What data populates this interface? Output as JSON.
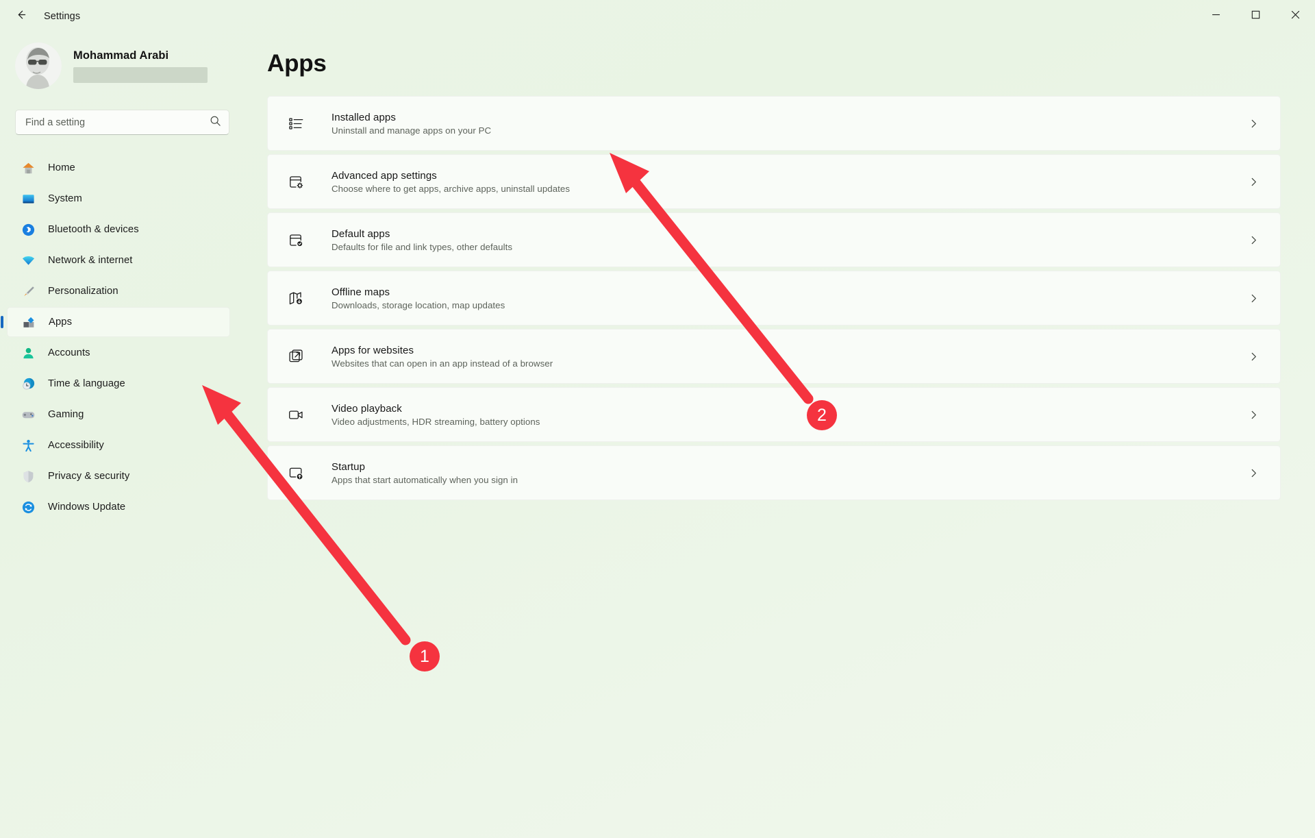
{
  "window": {
    "title": "Settings",
    "back_icon": "back-arrow-icon",
    "controls": {
      "minimize": "minimize-icon",
      "maximize": "maximize-icon",
      "close": "close-icon"
    }
  },
  "account": {
    "name": "Mohammad Arabi",
    "email_redacted": true,
    "avatar_alt": "user-avatar"
  },
  "search": {
    "placeholder": "Find a setting",
    "value": "",
    "icon": "search-icon"
  },
  "sidebar": {
    "items": [
      {
        "label": "Home",
        "icon": "home-icon",
        "selected": false
      },
      {
        "label": "System",
        "icon": "system-icon",
        "selected": false
      },
      {
        "label": "Bluetooth & devices",
        "icon": "bluetooth-icon",
        "selected": false
      },
      {
        "label": "Network & internet",
        "icon": "network-icon",
        "selected": false
      },
      {
        "label": "Personalization",
        "icon": "personalization-icon",
        "selected": false
      },
      {
        "label": "Apps",
        "icon": "apps-icon",
        "selected": true
      },
      {
        "label": "Accounts",
        "icon": "accounts-icon",
        "selected": false
      },
      {
        "label": "Time & language",
        "icon": "time-language-icon",
        "selected": false
      },
      {
        "label": "Gaming",
        "icon": "gaming-icon",
        "selected": false
      },
      {
        "label": "Accessibility",
        "icon": "accessibility-icon",
        "selected": false
      },
      {
        "label": "Privacy & security",
        "icon": "privacy-security-icon",
        "selected": false
      },
      {
        "label": "Windows Update",
        "icon": "windows-update-icon",
        "selected": false
      }
    ]
  },
  "main": {
    "page_title": "Apps",
    "cards": [
      {
        "title": "Installed apps",
        "subtitle": "Uninstall and manage apps on your PC",
        "icon": "installed-apps-list-icon",
        "chevron": "chevron-right-icon"
      },
      {
        "title": "Advanced app settings",
        "subtitle": "Choose where to get apps, archive apps, uninstall updates",
        "icon": "advanced-app-settings-gear-icon",
        "chevron": "chevron-right-icon"
      },
      {
        "title": "Default apps",
        "subtitle": "Defaults for file and link types, other defaults",
        "icon": "default-apps-check-icon",
        "chevron": "chevron-right-icon"
      },
      {
        "title": "Offline maps",
        "subtitle": "Downloads, storage location, map updates",
        "icon": "offline-maps-download-icon",
        "chevron": "chevron-right-icon"
      },
      {
        "title": "Apps for websites",
        "subtitle": "Websites that can open in an app instead of a browser",
        "icon": "apps-for-websites-external-link-icon",
        "chevron": "chevron-right-icon"
      },
      {
        "title": "Video playback",
        "subtitle": "Video adjustments, HDR streaming, battery options",
        "icon": "video-playback-camera-icon",
        "chevron": "chevron-right-icon"
      },
      {
        "title": "Startup",
        "subtitle": "Apps that start automatically when you sign in",
        "icon": "startup-upload-icon",
        "chevron": "chevron-right-icon"
      }
    ]
  },
  "annotations": {
    "color": "#f5333f",
    "markers": [
      {
        "label": "1",
        "target": "sidebar-item-apps"
      },
      {
        "label": "2",
        "target": "card-installed-apps"
      }
    ]
  },
  "colors": {
    "page_background": "#eaf4e6",
    "card_background": "#f9fcf8",
    "accent_selected": "#1668c1",
    "annotation_red": "#f5333f",
    "text_primary": "#1b1b1b",
    "text_secondary": "#5d635b"
  }
}
